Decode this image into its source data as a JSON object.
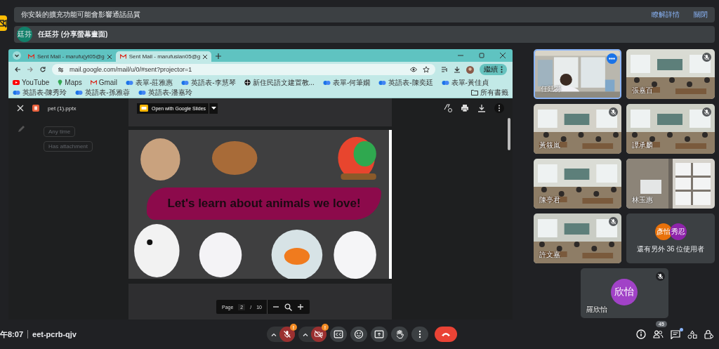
{
  "notice": {
    "text": "你安裝的擴充功能可能會影響通話品質",
    "links": [
      "瞭解詳情",
      "關閉"
    ]
  },
  "presenter": {
    "initials": "廷芬",
    "label": "任廷芬 (分享螢幕畫面)"
  },
  "browser": {
    "tabs": [
      {
        "title": "Sent Mail - marufu(yt05@g",
        "selected": false
      },
      {
        "title": "Sent Mail - marufuslan05@g",
        "selected": true
      }
    ],
    "url": "mail.google.com/mail/u/0/#sent?projector=1",
    "profile_button": "繼續",
    "bookmarks": [
      {
        "kind": "youtube",
        "label": "YouTube"
      },
      {
        "kind": "maps",
        "label": "Maps"
      },
      {
        "kind": "gmail",
        "label": "Gmail"
      },
      {
        "kind": "edu",
        "label": "表單-莊雅惠"
      },
      {
        "kind": "edu",
        "label": "英語表-李慧琴"
      },
      {
        "kind": "globe",
        "label": "新住民語文建置教..."
      },
      {
        "kind": "edu",
        "label": "表單-何筆嫺"
      },
      {
        "kind": "edu",
        "label": "英語表-陳奕廷"
      },
      {
        "kind": "edu",
        "label": "表單-黃佳貞"
      },
      {
        "kind": "edu",
        "label": "英語表-陳秀玲"
      },
      {
        "kind": "edu",
        "label": "英語表-孫雅蓉"
      },
      {
        "kind": "edu",
        "label": "英語表-潘嘉玲"
      }
    ],
    "all_bookmarks": "所有書籤"
  },
  "gmail": {
    "filters": [
      "Any time",
      "Has attachment"
    ]
  },
  "viewer": {
    "file_name": "pet (1).pptx",
    "open_with": "Open with Google Slides",
    "slide_title": "Let's learn about animals we love!",
    "page_label": "Page",
    "page": "2",
    "page_sep": "/",
    "page_total": "10"
  },
  "tiles": [
    {
      "kind": "video",
      "name": "任廷芬",
      "muted": false,
      "speaking": true
    },
    {
      "kind": "video",
      "name": "張嘉百",
      "muted": true,
      "speaking": false
    },
    {
      "kind": "video",
      "name": "黃筱嵐",
      "muted": true,
      "speaking": false
    },
    {
      "kind": "video",
      "name": "譚承麟",
      "muted": true,
      "speaking": false
    },
    {
      "kind": "video",
      "name": "陳亭君",
      "muted": false,
      "speaking": false
    },
    {
      "kind": "video",
      "name": "林玉惠",
      "muted": false,
      "speaking": false
    },
    {
      "kind": "video",
      "name": "許文嘉",
      "muted": true,
      "speaking": false
    },
    {
      "kind": "avatars",
      "avatars": [
        {
          "initials": "彥怡",
          "color": "#e8710a"
        },
        {
          "initials": "秀忍",
          "color": "#8e24aa"
        }
      ],
      "others": "還有另外 36 位使用者",
      "muted": false,
      "speaking": false
    },
    {
      "kind": "avatar",
      "avatars": [
        {
          "initials": "欣怡",
          "color": "#a142c7"
        }
      ],
      "name": "羅欣怡",
      "muted": true,
      "speaking": false
    }
  ],
  "meeting": {
    "time": "午8:07",
    "code": "eet-pcrb-qjv"
  },
  "controls": [
    {
      "kind": "mic",
      "off": true,
      "warning": "!"
    },
    {
      "kind": "camera",
      "off": true,
      "warning": "!"
    },
    {
      "kind": "captions"
    },
    {
      "kind": "emoji"
    },
    {
      "kind": "present"
    },
    {
      "kind": "hand"
    },
    {
      "kind": "more"
    },
    {
      "kind": "end"
    }
  ],
  "side_controls": [
    {
      "kind": "info"
    },
    {
      "kind": "people",
      "badge": "45"
    },
    {
      "kind": "chat",
      "unread": true
    },
    {
      "kind": "activities"
    },
    {
      "kind": "lock"
    }
  ]
}
